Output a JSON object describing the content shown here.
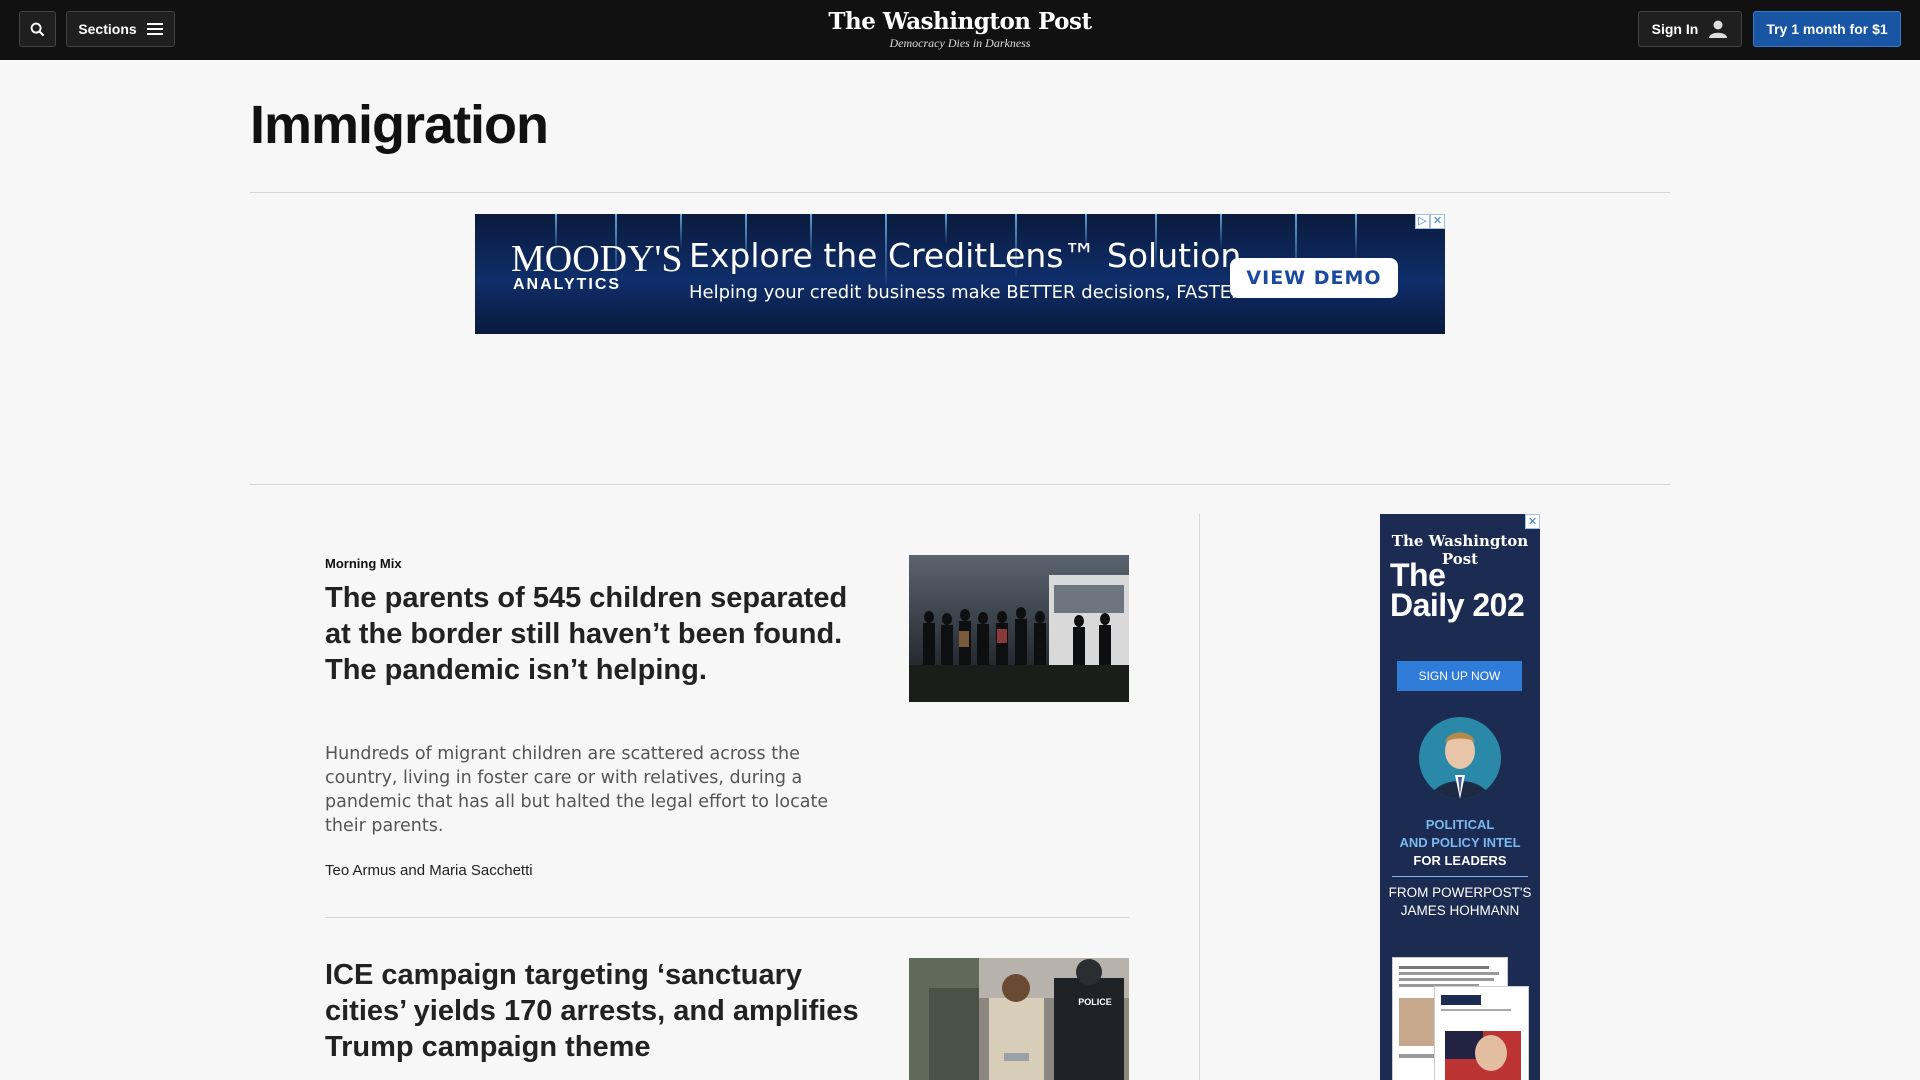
{
  "header": {
    "sections_label": "Sections",
    "logo_name": "The Washington Post",
    "logo_tagline": "Democracy Dies in Darkness",
    "signin_label": "Sign In",
    "subscribe_label": "Try 1 month for $1"
  },
  "page": {
    "title": "Immigration"
  },
  "top_ad": {
    "brand": "MOODY'S",
    "brand_sub": "ANALYTICS",
    "headline": "Explore the CreditLens™ Solution",
    "subline": "Helping your credit business make BETTER decisions, FASTER",
    "cta": "VIEW DEMO"
  },
  "articles": [
    {
      "kicker": "Morning Mix",
      "headline": "The parents of 545 children separated at the border still haven’t been found. The pandemic isn’t helping.",
      "blurb": "Hundreds of migrant children are scattered across the country, living in foster care or with relatives, during a pandemic that has all but halted the legal effort to locate their parents.",
      "byline": "Teo Armus and Maria Sacchetti"
    },
    {
      "headline": "ICE campaign targeting ‘sanctuary cities’ yields 170 arrests, and amplifies Trump campaign theme",
      "photo_text": "POLICE"
    }
  ],
  "side_ad": {
    "logo": "The Washington Post",
    "title_line1": "The",
    "title_line2": "Daily 202",
    "cta": "SIGN UP NOW",
    "intel_line1": "POLITICAL",
    "intel_line2": "AND POLICY INTEL",
    "intel_line3": "FOR LEADERS",
    "from_line1": "FROM POWERPOST'S",
    "from_line2": "JAMES HOHMANN"
  },
  "colors": {
    "nav_bg": "#111111",
    "subscribe_bg": "#1955a5",
    "page_bg": "#f7f7f7",
    "side_ad_bg": "#1c2b52"
  }
}
